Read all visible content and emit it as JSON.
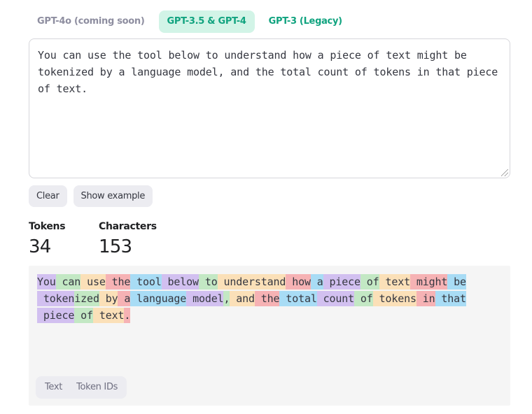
{
  "tabs": [
    {
      "label": "GPT-4o (coming soon)",
      "state": "disabled"
    },
    {
      "label": "GPT-3.5 & GPT-4",
      "state": "active"
    },
    {
      "label": "GPT-3 (Legacy)",
      "state": "normal"
    }
  ],
  "input": {
    "value": "You can use the tool below to understand how a piece of text might be tokenized by a language model, and the total count of tokens in that piece of text."
  },
  "buttons": {
    "clear_label": "Clear",
    "show_example_label": "Show example"
  },
  "stats": {
    "tokens_label": "Tokens",
    "tokens_value": "34",
    "characters_label": "Characters",
    "characters_value": "153"
  },
  "token_colors": [
    "#d2c0f0",
    "#c3e8c4",
    "#fbe0b8",
    "#f6b2b4",
    "#a8dcf5"
  ],
  "tokens": [
    "You",
    " can",
    " use",
    " the",
    " tool",
    " below",
    " to",
    " understand",
    " how",
    " a",
    " piece",
    " of",
    " text",
    " might",
    " be",
    "\n",
    " token",
    "ized",
    " by",
    " a",
    " language",
    " model",
    ",",
    " and",
    " the",
    " total",
    " count",
    " of",
    " tokens",
    " in",
    " that",
    "\n",
    " piece",
    " of",
    " text",
    "."
  ],
  "view_toggle": {
    "text_label": "Text",
    "token_ids_label": "Token IDs"
  }
}
